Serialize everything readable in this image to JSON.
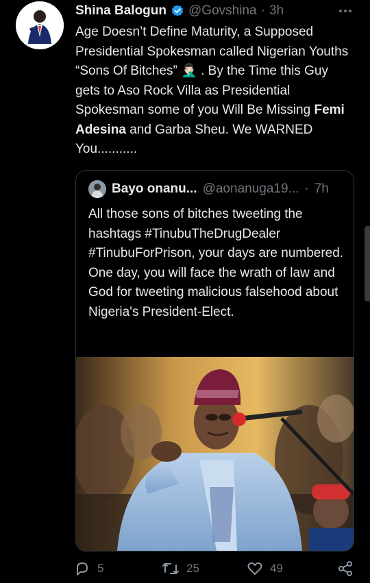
{
  "tweet": {
    "author_name": "Shina Balogun",
    "handle": "@Govshina",
    "separator": "·",
    "time": "3h",
    "text_part1": "Age Doesn’t Define Maturity, a Supposed Presidential Spokesman called Nigerian Youths “Sons Of Bitches” 🤦🏻‍♂️ . By the Time this Guy gets to Aso Rock Villa as Presidential Spokesman some of you Will Be Missing ",
    "text_bold": "Femi Adesina",
    "text_part2": " and Garba Sheu. We WARNED You..........."
  },
  "quoted": {
    "author_name": "Bayo onanu...",
    "handle": "@aonanuga19...",
    "separator": "·",
    "time": "7h",
    "text": "All those sons of bitches tweeting the hashtags #TinubuTheDrugDealer #TinubuForPrison, your days are numbered. One day, you will face the wrath of law and God for tweeting malicious falsehood about Nigeria's President-Elect."
  },
  "actions": {
    "replies": "5",
    "retweets": "25",
    "likes": "49"
  },
  "icons": {
    "verified": "verified-badge-icon",
    "more": "more-dots-icon",
    "reply": "reply-icon",
    "retweet": "retweet-icon",
    "like": "heart-icon",
    "share": "share-icon"
  },
  "colors": {
    "background": "#000000",
    "text": "#e7e9ea",
    "muted": "#71767b",
    "verified": "#1d9bf0",
    "border": "#2f3336"
  }
}
